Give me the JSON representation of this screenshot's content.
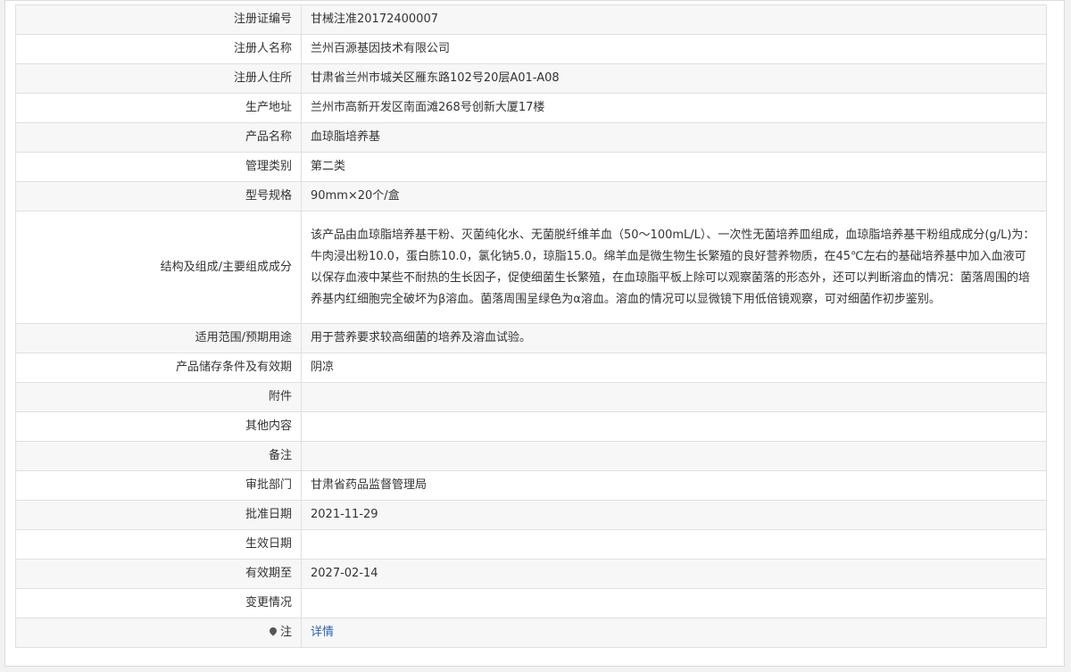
{
  "rows": [
    {
      "label": "注册证编号",
      "value": "甘械注准20172400007"
    },
    {
      "label": "注册人名称",
      "value": "兰州百源基因技术有限公司"
    },
    {
      "label": "注册人住所",
      "value": "甘肃省兰州市城关区雁东路102号20层A01-A08"
    },
    {
      "label": "生产地址",
      "value": "兰州市高新开发区南面滩268号创新大厦17楼"
    },
    {
      "label": "产品名称",
      "value": "血琼脂培养基"
    },
    {
      "label": "管理类别",
      "value": "第二类"
    },
    {
      "label": "型号规格",
      "value": "90mm×20个/盒"
    },
    {
      "label": "结构及组成/主要组成成分",
      "value": "该产品由血琼脂培养基干粉、灭菌纯化水、无菌脱纤维羊血（50～100mL/L）、一次性无菌培养皿组成，血琼脂培养基干粉组成成分(g/L)为：牛肉浸出粉10.0，蛋白胨10.0，氯化钠5.0，琼脂15.0。绵羊血是微生物生长繁殖的良好营养物质，在45℃左右的基础培养基中加入血液可以保存血液中某些不耐热的生长因子，促使细菌生长繁殖，在血琼脂平板上除可以观察菌落的形态外，还可以判断溶血的情况：菌落周围的培养基内红细胞完全破坏为β溶血。菌落周围呈绿色为α溶血。溶血的情况可以显微镜下用低倍镜观察，可对细菌作初步鉴别。"
    },
    {
      "label": "适用范围/预期用途",
      "value": "用于营养要求较高细菌的培养及溶血试验。"
    },
    {
      "label": "产品储存条件及有效期",
      "value": "阴凉"
    },
    {
      "label": "附件",
      "value": ""
    },
    {
      "label": "其他内容",
      "value": ""
    },
    {
      "label": "备注",
      "value": ""
    },
    {
      "label": "审批部门",
      "value": "甘肃省药品监督管理局"
    },
    {
      "label": "批准日期",
      "value": "2021-11-29"
    },
    {
      "label": "生效日期",
      "value": ""
    },
    {
      "label": "有效期至",
      "value": "2027-02-14"
    },
    {
      "label": "变更情况",
      "value": ""
    },
    {
      "label": "注",
      "value": "详情"
    }
  ],
  "note_icon": "map-pin-icon"
}
